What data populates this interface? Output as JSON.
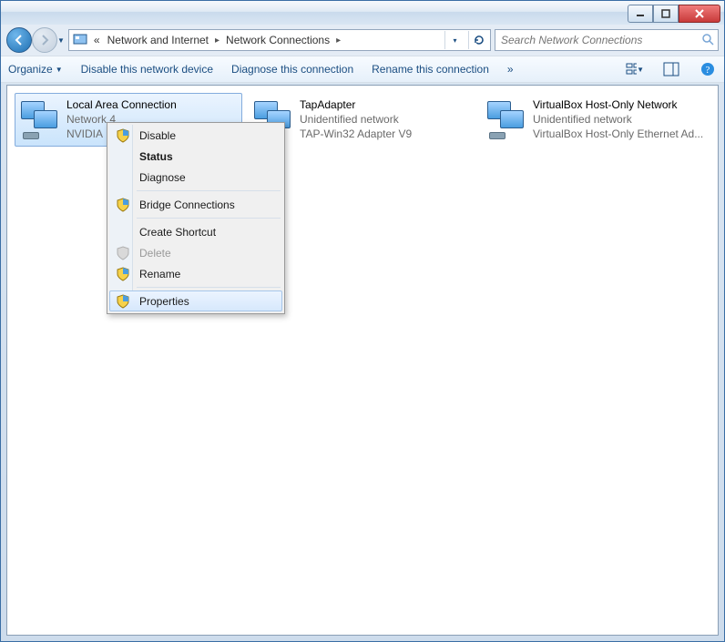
{
  "breadcrumb": {
    "prefix": "«",
    "item1": "Network and Internet",
    "item2": "Network Connections"
  },
  "search": {
    "placeholder": "Search Network Connections"
  },
  "toolbar": {
    "organize": "Organize",
    "disable": "Disable this network device",
    "diagnose": "Diagnose this connection",
    "rename": "Rename this connection",
    "more_chevron": "»"
  },
  "connections": [
    {
      "name": "Local Area Connection",
      "status": "Network 4",
      "adapter": "NVIDIA"
    },
    {
      "name": "TapAdapter",
      "status": "Unidentified network",
      "adapter": "TAP-Win32 Adapter V9"
    },
    {
      "name": "VirtualBox Host-Only Network",
      "status": "Unidentified network",
      "adapter": "VirtualBox Host-Only Ethernet Ad..."
    }
  ],
  "context_menu": {
    "disable": "Disable",
    "status": "Status",
    "diagnose": "Diagnose",
    "bridge": "Bridge Connections",
    "shortcut": "Create Shortcut",
    "delete": "Delete",
    "rename": "Rename",
    "properties": "Properties"
  }
}
